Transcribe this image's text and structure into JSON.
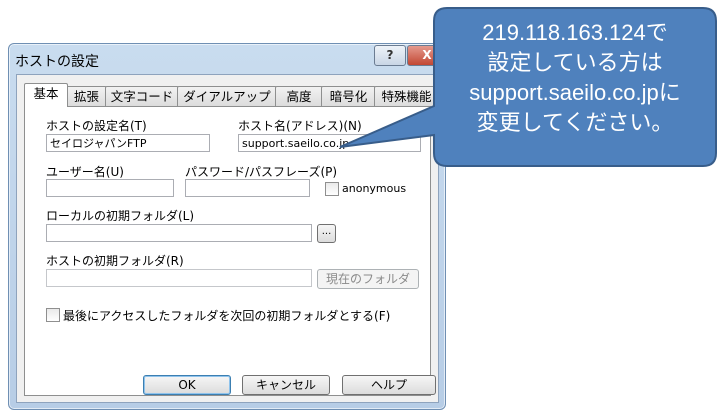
{
  "window": {
    "title": "ホストの設定",
    "help_glyph": "?",
    "close_glyph": "X"
  },
  "tabs": [
    "基本",
    "拡張",
    "文字コード",
    "ダイアルアップ",
    "高度",
    "暗号化",
    "特殊機能"
  ],
  "form": {
    "host_setting_name_label": "ホストの設定名(T)",
    "host_setting_name_value": "セイロジャパンFTP",
    "host_name_label": "ホスト名(アドレス)(N)",
    "host_name_value": "support.saeilo.co.jp",
    "username_label": "ユーザー名(U)",
    "username_value": "",
    "password_label": "パスワード/パスフレーズ(P)",
    "password_value": "",
    "anonymous_label": "anonymous",
    "local_folder_label": "ローカルの初期フォルダ(L)",
    "local_folder_value": "",
    "browse_label": "...",
    "host_folder_label": "ホストの初期フォルダ(R)",
    "host_folder_value": "",
    "current_folder_button": "現在のフォルダ",
    "last_folder_checkbox_label": "最後にアクセスしたフォルダを次回の初期フォルダとする(F)"
  },
  "buttons": {
    "ok": "OK",
    "cancel": "キャンセル",
    "help": "ヘルプ"
  },
  "callout": {
    "lines": [
      "219.118.163.124で",
      "設定している方は",
      "support.saeilo.co.jpに",
      "変更してください。"
    ],
    "fill": "#4f81bd",
    "stroke": "#385d8a"
  }
}
